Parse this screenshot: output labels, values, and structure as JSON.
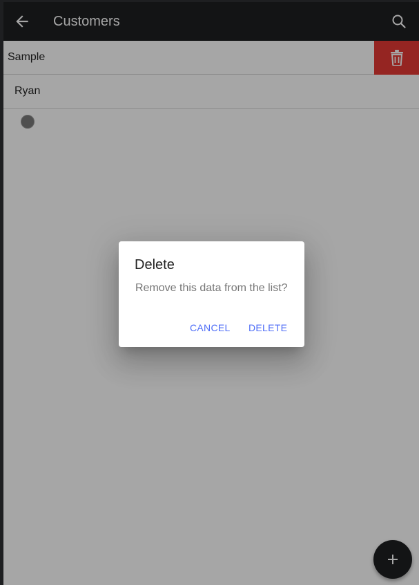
{
  "header": {
    "title": "Customers",
    "back_icon": "arrow-left-icon",
    "search_icon": "search-icon",
    "background": "#1e1f21"
  },
  "list": {
    "items": [
      {
        "label": "Sample",
        "swiped": true
      },
      {
        "label": "Ryan",
        "swiped": false
      }
    ],
    "swipe_action": {
      "icon": "trash-icon",
      "color": "#e53935"
    }
  },
  "dialog": {
    "title": "Delete",
    "message": "Remove this data from the list?",
    "cancel_label": "CANCEL",
    "confirm_label": "DELETE",
    "button_color": "#4f6ef7"
  },
  "fab": {
    "icon": "plus-icon"
  }
}
